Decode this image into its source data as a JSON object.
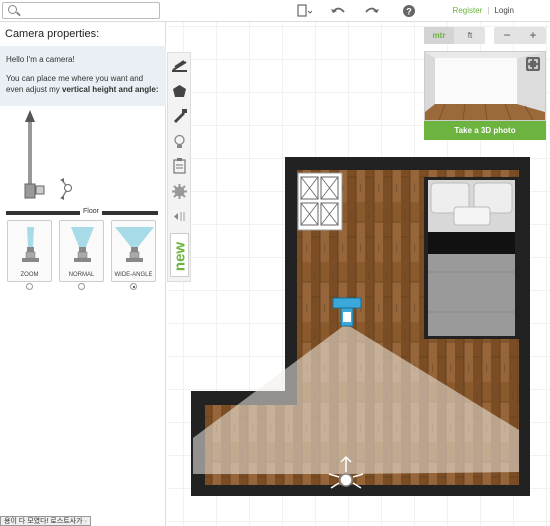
{
  "topbar": {
    "search_placeholder": "",
    "register": "Register",
    "separator": "|",
    "login": "Login",
    "icons": [
      "page-icon",
      "undo-icon",
      "redo-icon",
      "help-icon"
    ]
  },
  "camera_panel": {
    "title": "Camera properties:",
    "greeting": "Hello I'm a camera!",
    "description_prefix": "You can place me where you want and even adjust my ",
    "description_bold": "vertical height and angle:",
    "floor_label": "Floor",
    "lenses": [
      {
        "label": "ZOOM",
        "selected": false
      },
      {
        "label": "NORMAL",
        "selected": false
      },
      {
        "label": "WIDE-ANGLE",
        "selected": true
      }
    ]
  },
  "toolbar": {
    "tools": [
      "wall-icon",
      "shape-icon",
      "paint-icon",
      "light-icon",
      "clipboard-icon",
      "settings-icon",
      "collapse-icon"
    ],
    "new_label": "new"
  },
  "view_controls": {
    "unit_metric": "mtr",
    "unit_imperial": "ft",
    "zoom_out": "−",
    "zoom_in": "+",
    "photo_button": "Take a 3D photo"
  },
  "colors": {
    "accent": "#6cb33f",
    "wall": "#222222",
    "floor": "#8a5a2c"
  },
  "footer_note": "용이 다 모였다! 로스트사가 ·"
}
